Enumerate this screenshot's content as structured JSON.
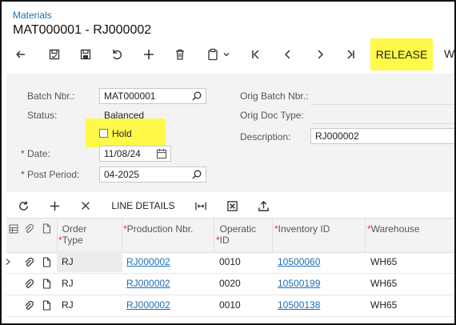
{
  "breadcrumb": "Materials",
  "title": "MAT000001 - RJ000002",
  "toolbar": {
    "release_label": "RELEASE",
    "more_label": "W"
  },
  "form": {
    "batch_nbr_label": "Batch Nbr.:",
    "batch_nbr_value": "MAT000001",
    "status_label": "Status:",
    "status_value": "Balanced",
    "hold_label": "Hold",
    "hold_checked": false,
    "date_label": "Date:",
    "date_value": "11/08/24",
    "post_period_label": "Post Period:",
    "post_period_value": "04-2025",
    "orig_batch_label": "Orig Batch Nbr.:",
    "orig_doc_type_label": "Orig Doc Type:",
    "description_label": "Description:",
    "description_value": "RJ000002"
  },
  "grid": {
    "line_details_label": "LINE DETAILS",
    "columns": {
      "order_type": "Order Type",
      "production_nbr": "Production Nbr.",
      "operation_id": "Operatic ID",
      "inventory_id": "Inventory ID",
      "warehouse": "Warehouse"
    },
    "rows": [
      {
        "order_type": "RJ",
        "production_nbr": "RJ000002",
        "operation_id": "0010",
        "inventory_id": "10500060",
        "warehouse": "WH65"
      },
      {
        "order_type": "RJ",
        "production_nbr": "RJ000002",
        "operation_id": "0020",
        "inventory_id": "10500199",
        "warehouse": "WH65"
      },
      {
        "order_type": "RJ",
        "production_nbr": "RJ000002",
        "operation_id": "0010",
        "inventory_id": "10500138",
        "warehouse": "WH65"
      }
    ]
  },
  "colors": {
    "link": "#1a6fb8",
    "highlight": "#fff94a",
    "required": "#d33333"
  }
}
